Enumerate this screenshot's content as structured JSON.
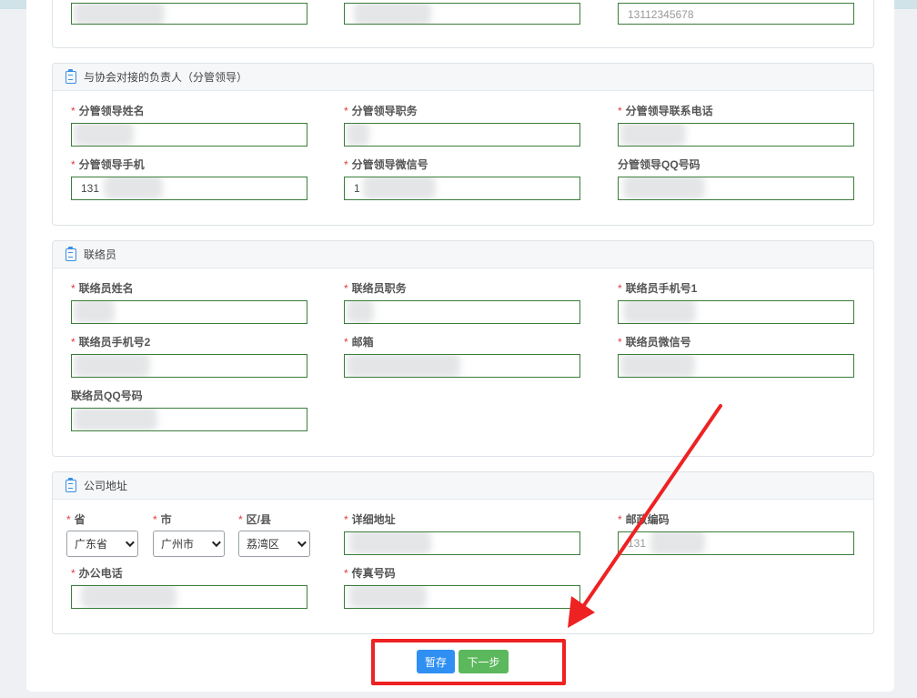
{
  "partial_section": {
    "col3_value": "13112345678"
  },
  "leader_section": {
    "title": "与协会对接的负责人（分管领导）",
    "fields": {
      "name": "分管领导姓名",
      "position": "分管领导职务",
      "phone": "分管领导联系电话",
      "mobile": "分管领导手机",
      "wechat": "分管领导微信号",
      "qq": "分管领导QQ号码"
    },
    "values": {
      "mobile": "131",
      "wechat": "1"
    }
  },
  "contact_section": {
    "title": "联络员",
    "fields": {
      "name": "联络员姓名",
      "position": "联络员职务",
      "mobile1": "联络员手机号1",
      "mobile2": "联络员手机号2",
      "email": "邮箱",
      "wechat": "联络员微信号",
      "qq": "联络员QQ号码"
    }
  },
  "address_section": {
    "title": "公司地址",
    "fields": {
      "province": "省",
      "city": "市",
      "district": "区/县",
      "detail": "详细地址",
      "postcode": "邮政编码",
      "office_phone": "办公电话",
      "fax": "传真号码"
    },
    "values": {
      "province": "广东省",
      "city": "广州市",
      "district": "荔湾区",
      "postcode": "131"
    }
  },
  "actions": {
    "save_label": "暂存",
    "next_label": "下一步"
  },
  "colors": {
    "save_button": "#2f8ff2",
    "next_button": "#5cb85c",
    "required_star": "#e03b3b",
    "input_border": "#3a7d3a",
    "annotation": "#ee2222"
  },
  "icons": {
    "section_icon": "clipboard-icon",
    "select_arrow": "chevron-down-icon"
  }
}
